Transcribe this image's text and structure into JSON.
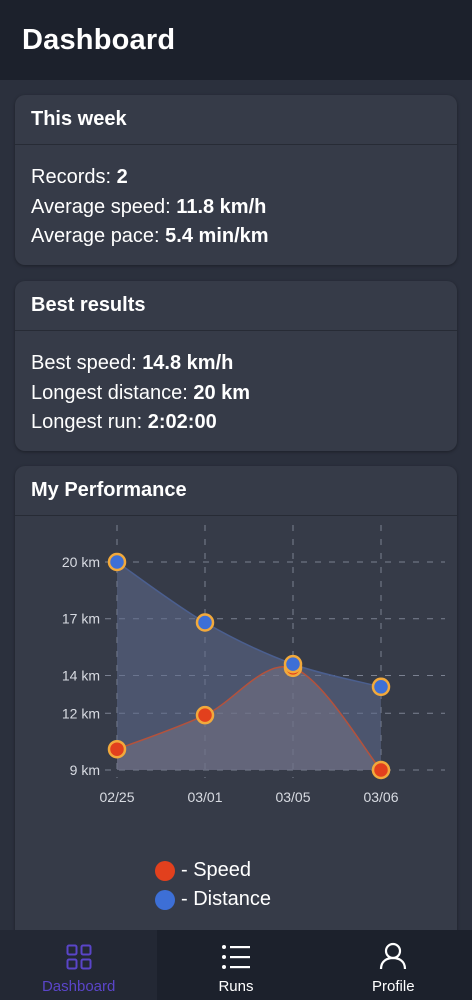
{
  "appbar": {
    "title": "Dashboard"
  },
  "week_card": {
    "title": "This week",
    "records_label": "Records: ",
    "records_value": "2",
    "avg_speed_label": "Average speed: ",
    "avg_speed_value": "11.8 km/h",
    "avg_pace_label": "Average pace: ",
    "avg_pace_value": "5.4 min/km"
  },
  "best_card": {
    "title": "Best results",
    "best_speed_label": "Best speed: ",
    "best_speed_value": "14.8 km/h",
    "longest_distance_label": "Longest distance: ",
    "longest_distance_value": "20 km",
    "longest_run_label": "Longest run: ",
    "longest_run_value": "2:02:00"
  },
  "performance_card": {
    "title": "My Performance"
  },
  "chart_data": {
    "type": "area",
    "categories": [
      "02/25",
      "03/01",
      "03/05",
      "03/06"
    ],
    "y_ticks": [
      "20 km",
      "17 km",
      "14 km",
      "12 km",
      "9 km"
    ],
    "y_tick_values": [
      20,
      17,
      14,
      12,
      9
    ],
    "ylim": [
      9,
      20
    ],
    "grid": true,
    "series": [
      {
        "name": "- Speed",
        "values": [
          10.1,
          11.9,
          14.4,
          9.0
        ],
        "color": "#e2401d"
      },
      {
        "name": "- Distance",
        "values": [
          20.0,
          16.8,
          14.6,
          13.4
        ],
        "color": "#3d6fd6"
      }
    ],
    "marker_border": "#f2a93b",
    "legend_position": "bottom"
  },
  "bottom_nav": {
    "items": [
      {
        "label": "Dashboard",
        "icon": "dashboard-icon",
        "active": true
      },
      {
        "label": "Runs",
        "icon": "list-icon",
        "active": false
      },
      {
        "label": "Profile",
        "icon": "person-icon",
        "active": false
      }
    ],
    "active_color": "#5a45c9"
  }
}
